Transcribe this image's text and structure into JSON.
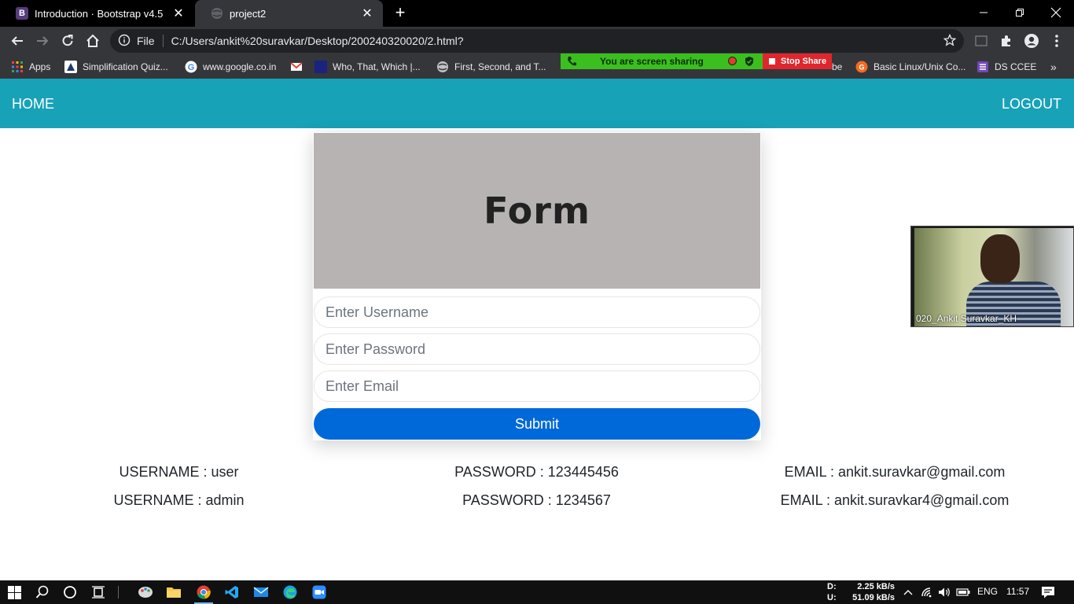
{
  "browser": {
    "tabs": [
      {
        "title": "Introduction · Bootstrap v4.5",
        "favicon": "B",
        "active": false
      },
      {
        "title": "project2",
        "active": true
      }
    ],
    "omnibox": {
      "scheme_label": "File",
      "url": "C:/Users/ankit%20suravkar/Desktop/200240320020/2.html?"
    },
    "bookmarks": [
      {
        "label": "Apps",
        "icon": "apps-grid-icon"
      },
      {
        "label": "Simplification Quiz...",
        "icon": "quiz-icon"
      },
      {
        "label": "www.google.co.in",
        "icon": "google-icon"
      },
      {
        "label": "",
        "icon": "gmail-icon"
      },
      {
        "label": "Who, That, Which |...",
        "icon": "site-icon"
      },
      {
        "label": "First, Second, and T...",
        "icon": "globe-icon"
      },
      {
        "label": "be",
        "icon": "youtube-icon"
      },
      {
        "label": "Basic Linux/Unix Co...",
        "icon": "guru-icon"
      },
      {
        "label": "DS CCEE",
        "icon": "list-icon"
      }
    ],
    "screen_share": {
      "status": "You are screen sharing",
      "stop_label": "Stop Share"
    }
  },
  "navbar": {
    "home": "HOME",
    "logout": "LOGOUT",
    "color": "#17a2b8"
  },
  "form": {
    "title": "Form",
    "username_placeholder": "Enter Username",
    "password_placeholder": "Enter Password",
    "email_placeholder": "Enter Email",
    "submit_label": "Submit",
    "accent": "#0069d9"
  },
  "credentials": [
    {
      "username": "USERNAME : user",
      "password": "PASSWORD : 123445456",
      "email": "EMAIL : ankit.suravkar@gmail.com"
    },
    {
      "username": "USERNAME : admin",
      "password": "PASSWORD : 1234567",
      "email": "EMAIL : ankit.suravkar4@gmail.com"
    }
  ],
  "video": {
    "participant_name": "020_Ankit Suravkar_KH"
  },
  "taskbar": {
    "download_label": "D:",
    "download_speed": "2.25 kB/s",
    "upload_label": "U:",
    "upload_speed": "51.09 kB/s",
    "language": "ENG",
    "time": "11:57"
  }
}
